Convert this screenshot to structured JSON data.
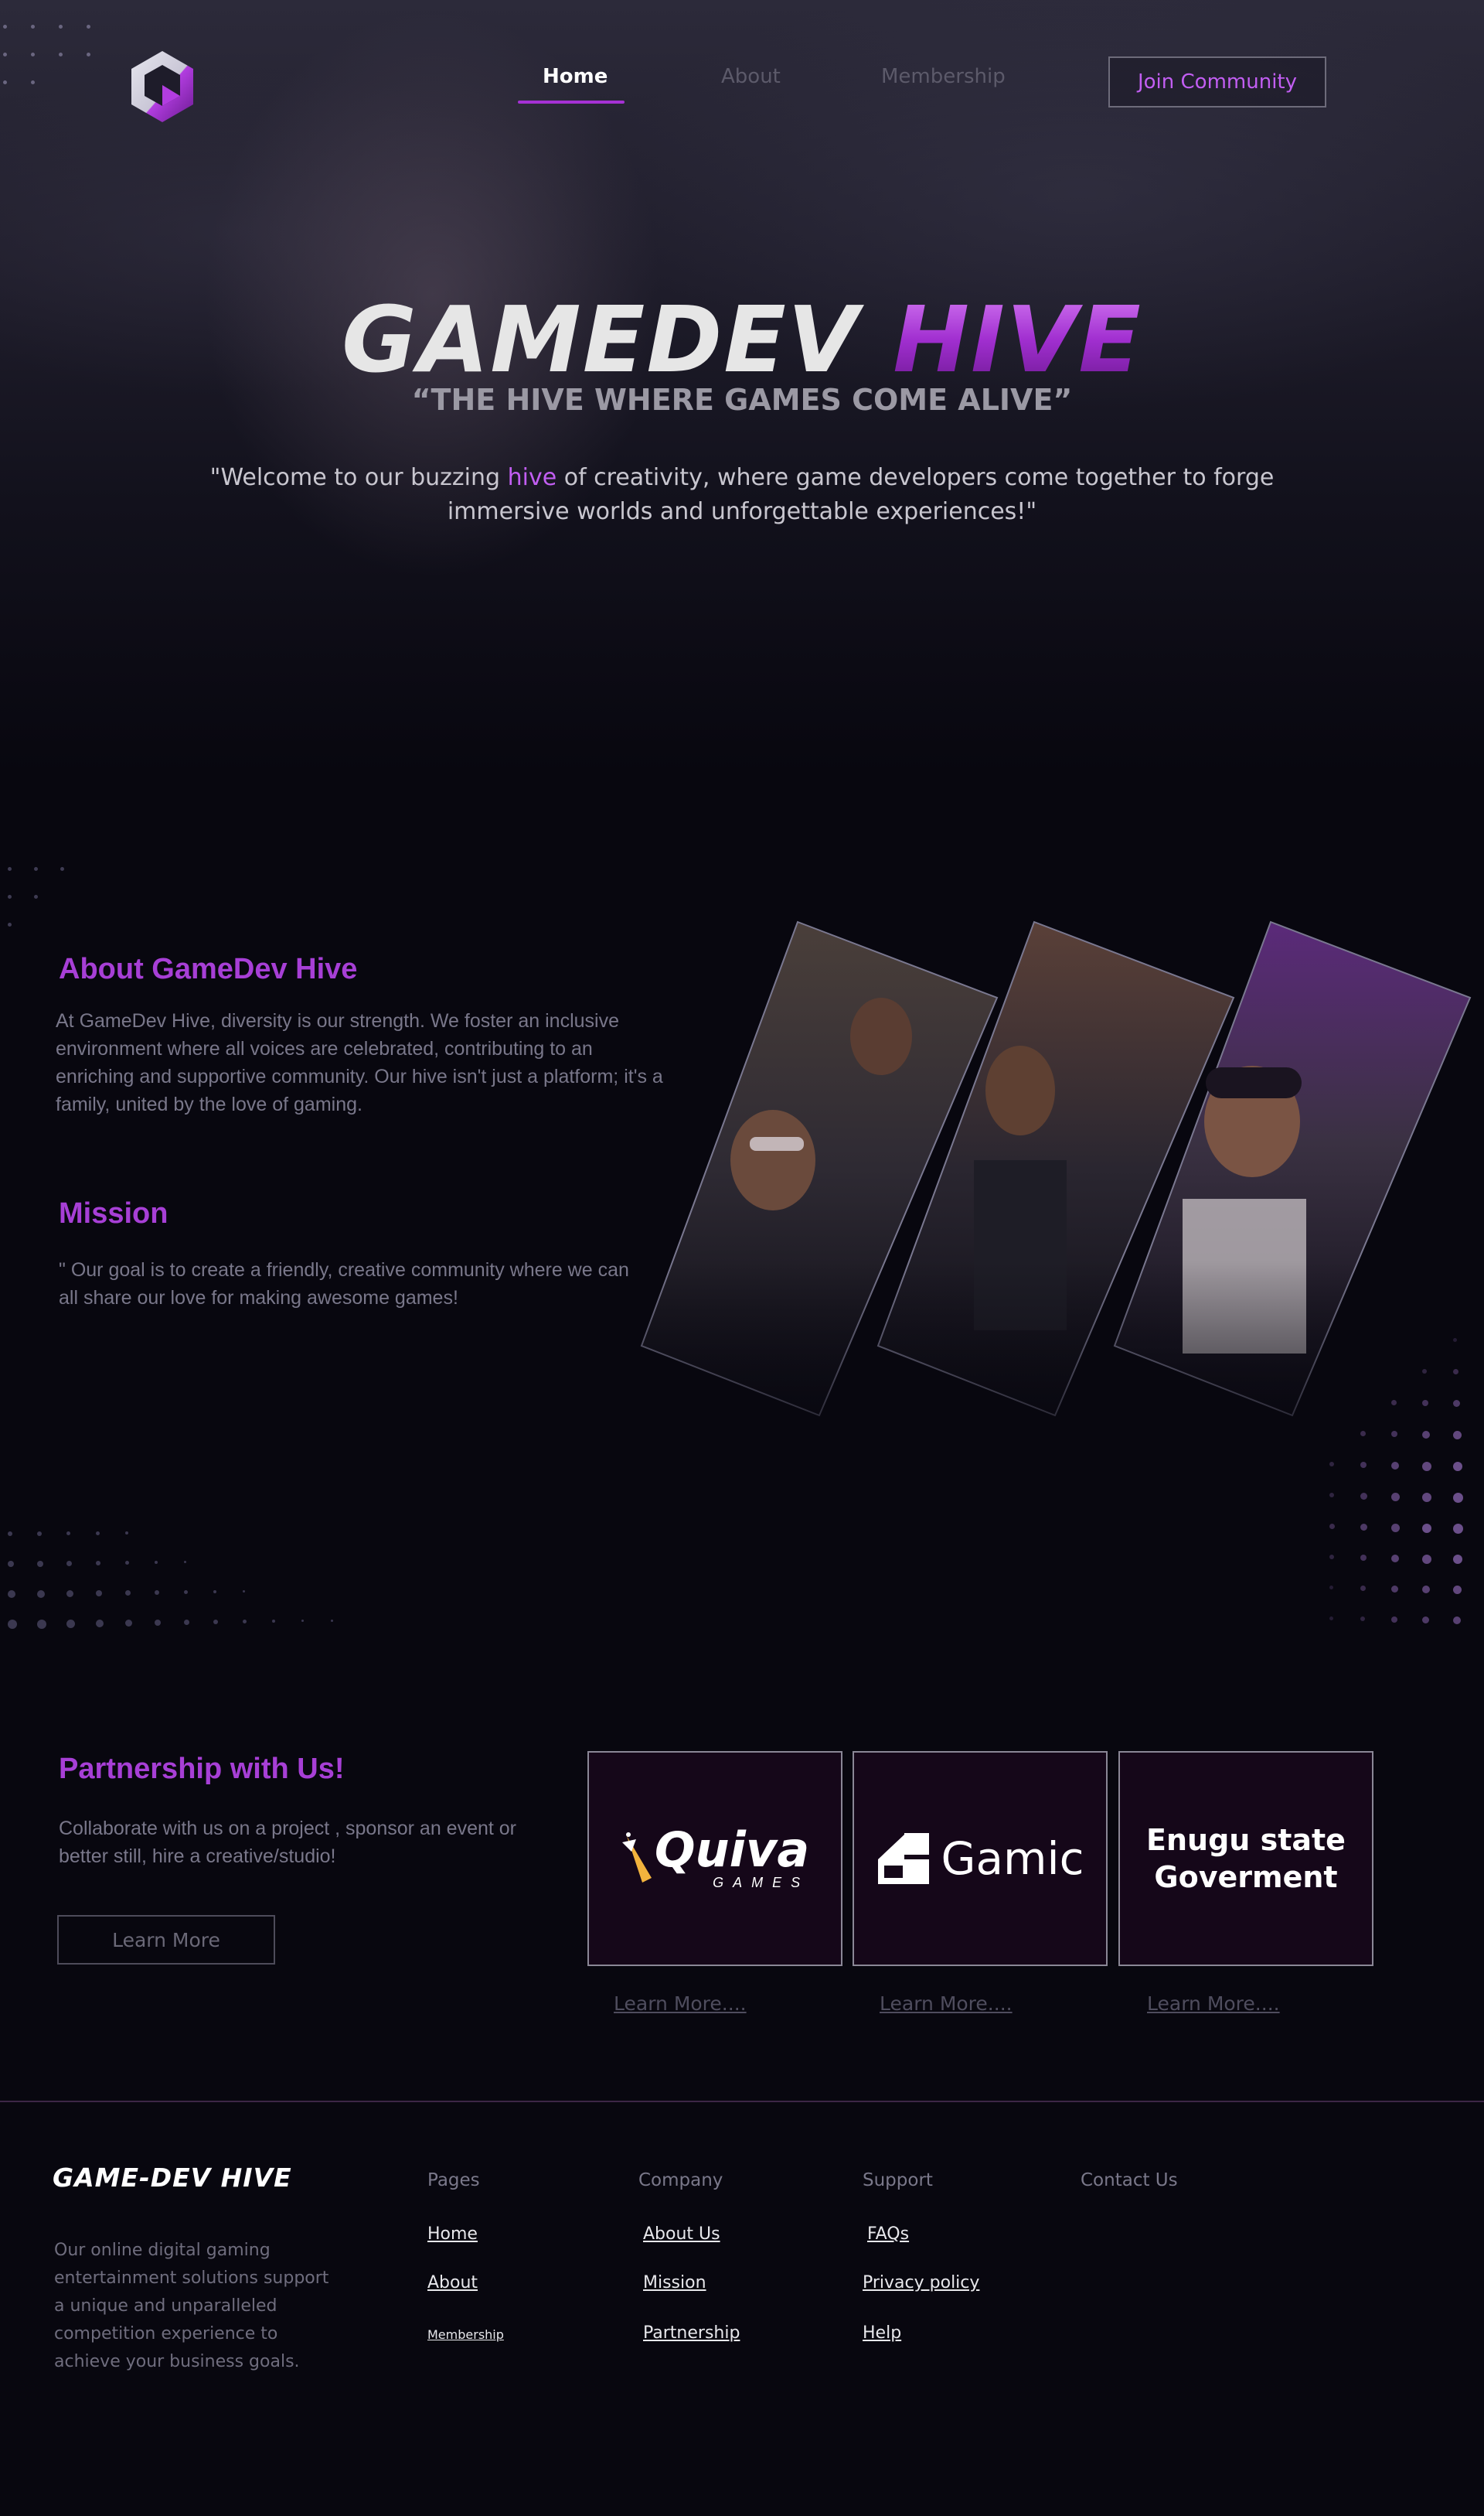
{
  "header": {
    "logo_icon": "hexagon-g-logo-icon",
    "nav": {
      "home": "Home",
      "about": "About",
      "membership": "Membership"
    },
    "join_button": "Join Community"
  },
  "hero": {
    "title_part1": "GAMEDEV",
    "title_part2": "HIVE",
    "tagline": "“THE HIVE WHERE GAMES COME ALIVE”",
    "welcome_before": "\"Welcome to our buzzing ",
    "welcome_highlight": "hive",
    "welcome_after": " of creativity, where game developers come together to forge immersive worlds and unforgettable experiences!\""
  },
  "about": {
    "title": "About GameDev Hive",
    "text": "At GameDev Hive, diversity is our strength. We foster an inclusive environment where all voices are celebrated, contributing to an enriching and supportive community. Our hive isn't just a platform; it's a family, united by the love of gaming."
  },
  "mission": {
    "title": "Mission",
    "text": "\" Our goal is to create a friendly, creative community where we can all share our love for making awesome games!"
  },
  "partnership": {
    "title": "Partnership with Us!",
    "text": "Collaborate with us on a project , sponsor an event or better still, hire a creative/studio!",
    "button": "Learn More",
    "partners": [
      {
        "name": "Quiva",
        "sub": "GAMES",
        "learn": "Learn More...."
      },
      {
        "name": "Gamic",
        "learn": "Learn More...."
      },
      {
        "name_line1": "Enugu state",
        "name_line2": "Goverment",
        "learn": "Learn More...."
      }
    ]
  },
  "footer": {
    "logo": "GAME-DEV HIVE",
    "description": "Our online digital gaming entertainment solutions support a unique and unparalleled competition experience to achieve your business goals.",
    "columns": {
      "pages": {
        "heading": "Pages",
        "items": [
          "Home",
          "About",
          "Membership"
        ]
      },
      "company": {
        "heading": "Company",
        "items": [
          "About Us",
          "Mission",
          "Partnership"
        ]
      },
      "support": {
        "heading": "Support",
        "items": [
          "FAQs",
          "Privacy policy",
          "Help"
        ]
      },
      "contact": {
        "heading": "Contact Us"
      }
    }
  },
  "colors": {
    "accent": "#a73fd6",
    "background": "#08070f",
    "card_background": "#150719"
  }
}
